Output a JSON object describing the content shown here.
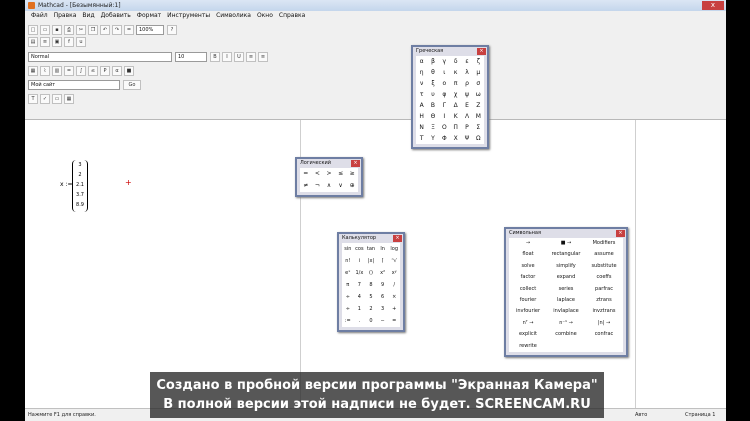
{
  "window": {
    "title": "Mathcad - [Безымянный:1]",
    "close": "x"
  },
  "menu": [
    "Файл",
    "Правка",
    "Вид",
    "Добавить",
    "Формат",
    "Инструменты",
    "Символика",
    "Окно",
    "Справка"
  ],
  "toolbar": {
    "zoom": "100%",
    "style": "Normal",
    "font": "Arial",
    "size": "10",
    "site": "Мой сайт",
    "go": "Go"
  },
  "document": {
    "var_label": "x :=",
    "matrix": [
      "3",
      "2",
      "2.1",
      "3.7",
      "8.9"
    ]
  },
  "palettes": {
    "greek": {
      "title": "Греческая",
      "rows": [
        [
          "α",
          "β",
          "γ",
          "δ",
          "ε",
          "ζ"
        ],
        [
          "η",
          "θ",
          "ι",
          "κ",
          "λ",
          "μ"
        ],
        [
          "ν",
          "ξ",
          "ο",
          "π",
          "ρ",
          "σ"
        ],
        [
          "τ",
          "υ",
          "φ",
          "χ",
          "ψ",
          "ω"
        ],
        [
          "Α",
          "Β",
          "Γ",
          "Δ",
          "Ε",
          "Ζ"
        ],
        [
          "Η",
          "Θ",
          "Ι",
          "Κ",
          "Λ",
          "Μ"
        ],
        [
          "Ν",
          "Ξ",
          "Ο",
          "Π",
          "Ρ",
          "Σ"
        ],
        [
          "Τ",
          "Υ",
          "Φ",
          "Χ",
          "Ψ",
          "Ω"
        ]
      ]
    },
    "boolean": {
      "title": "Логический",
      "rows": [
        [
          "=",
          "<",
          ">",
          "≤",
          "≥"
        ],
        [
          "≠",
          "¬",
          "∧",
          "∨",
          "⊕"
        ]
      ]
    },
    "calculator": {
      "title": "Калькулятор",
      "rows": [
        [
          "sin",
          "cos",
          "tan",
          "ln",
          "log"
        ],
        [
          "n!",
          "i",
          "|x|",
          "⌈",
          "ⁿ√"
        ],
        [
          "eˣ",
          "1/x",
          "()",
          "x²",
          "xʸ"
        ],
        [
          "π",
          "7",
          "8",
          "9",
          "/"
        ],
        [
          "÷",
          "4",
          "5",
          "6",
          "×"
        ],
        [
          "÷",
          "1",
          "2",
          "3",
          "+"
        ],
        [
          ":=",
          ".",
          "0",
          "−",
          "="
        ]
      ]
    },
    "symbolic": {
      "title": "Символьная",
      "rows": [
        [
          "→",
          "■ →",
          "Modifiers"
        ],
        [
          "float",
          "rectangular",
          "assume"
        ],
        [
          "solve",
          "simplify",
          "substitute"
        ],
        [
          "factor",
          "expand",
          "coeffs"
        ],
        [
          "collect",
          "series",
          "parfrac"
        ],
        [
          "fourier",
          "laplace",
          "ztrans"
        ],
        [
          "invfourier",
          "invlaplace",
          "invztrans"
        ],
        [
          "nᵀ →",
          "n⁻¹ →",
          "|n| →"
        ],
        [
          "explicit",
          "combine",
          "confrac"
        ],
        [
          "rewrite",
          "",
          ""
        ]
      ]
    }
  },
  "status": {
    "left": "Нажмите F1 для справки.",
    "mode": "Авто",
    "page": "Страница 1"
  },
  "watermark": {
    "line1": "Создано в пробной версии программы \"Экранная Камера\"",
    "line2": "В полной версии этой надписи не будет. SCREENCAM.RU"
  }
}
